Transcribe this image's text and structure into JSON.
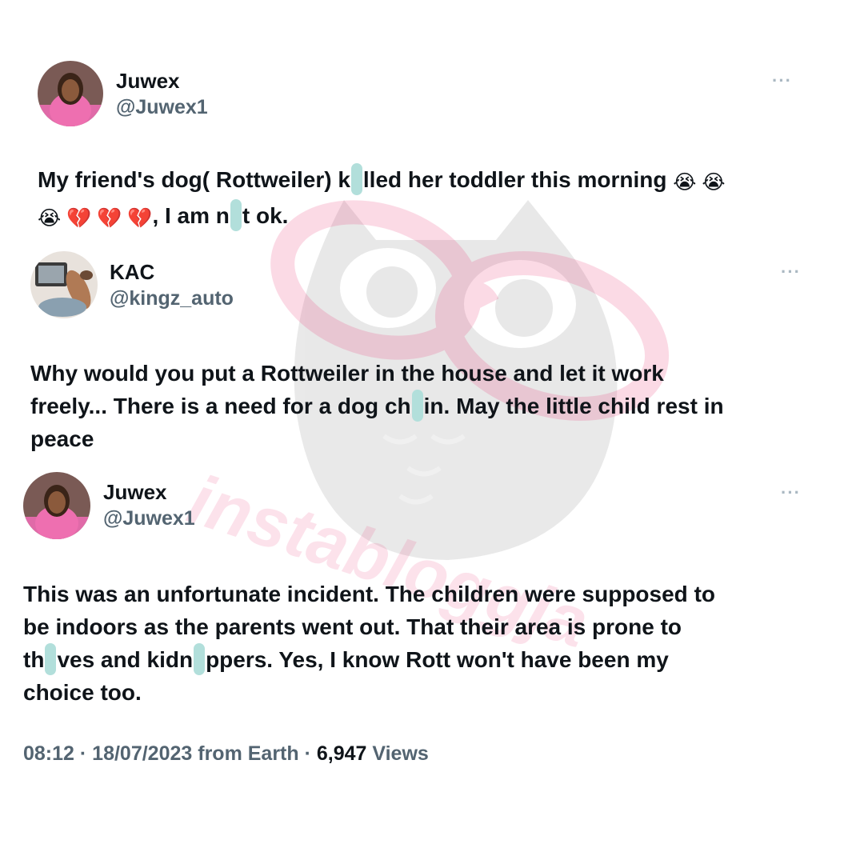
{
  "watermark": {
    "text": "instabloggja",
    "color": "#e91e63"
  },
  "tweets": [
    {
      "name": "Juwex",
      "handle": "@Juwex1",
      "more": "···",
      "body": {
        "l1a": "My friend's dog( Rottweiler) k",
        "l1b": "lled her toddler this morning",
        "l1emoji": "😭 😭",
        "l2emoji": "😭 💔 💔 💔",
        "l2a": ", I am n",
        "l2b": "t ok."
      }
    },
    {
      "name": "KAC",
      "handle": "@kingz_auto",
      "more": "···",
      "body": {
        "l1": "Why would you put a Rottweiler in the house and let it work",
        "l2a": "freely... There is a need for a dog ch",
        "l2b": "in. May the little child rest in",
        "l3": "peace"
      }
    },
    {
      "name": "Juwex",
      "handle": "@Juwex1",
      "more": "···",
      "body": {
        "l1": "This was an unfortunate incident. The children were supposed to",
        "l2": "be indoors as the parents went out. That their area is prone to",
        "l3a": "th",
        "l3b": "ves and kidn",
        "l3c": "ppers. Yes, I know Rott won't have been my",
        "l4": "choice too."
      }
    }
  ],
  "meta": {
    "time": "08:12",
    "sep1": " · ",
    "date": "18/07/2023",
    "source": " from Earth",
    "sep2": " · ",
    "views_count": "6,947",
    "views_label": " Views"
  },
  "colors": {
    "text": "#0f1419",
    "muted": "#536471",
    "blot": "#b2dfdb"
  }
}
